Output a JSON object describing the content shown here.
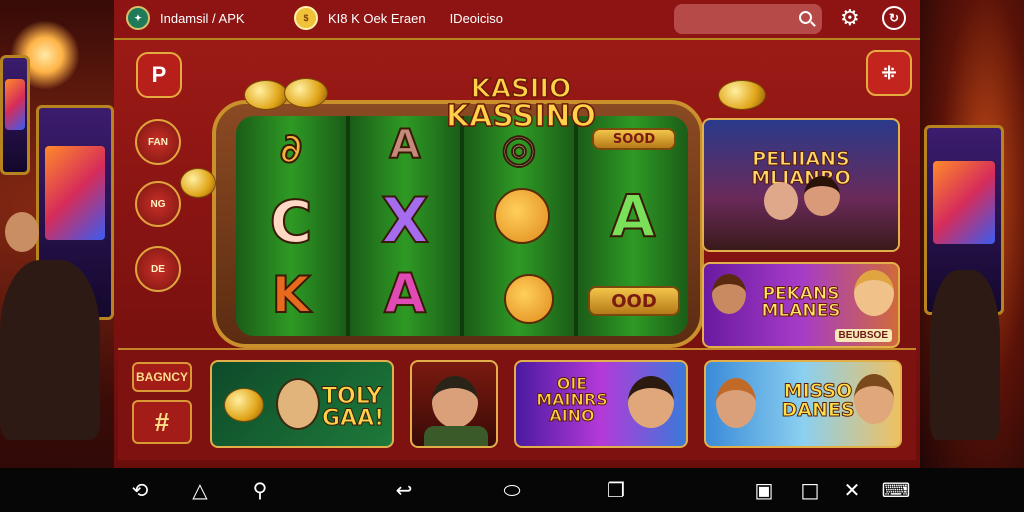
{
  "topbar": {
    "app_label": "Indamsil  / APK",
    "promo_label": "KI8 K  Oek Eraen",
    "promo_extra": "IDeoiciso"
  },
  "colors": {
    "panel": "#8d1412",
    "gold": "#e2b04a",
    "reel_green": "#2e9a24"
  },
  "icons": [
    "search-icon",
    "gear-icon",
    "refresh-icon",
    "menu-icon",
    "back-icon",
    "home-icon",
    "recents-icon"
  ],
  "logo": {
    "line1": "KASIIO",
    "line2": "KASSINO"
  },
  "side_buttons": {
    "first": "P",
    "second": "FAN",
    "third": "NG",
    "fourth": "DE"
  },
  "reels": {
    "col1": [
      "∂",
      "C",
      "K"
    ],
    "col2": [
      "A",
      "X",
      "A"
    ],
    "col3": [
      "◎",
      "",
      ""
    ],
    "col4": [
      "SOOD",
      "A",
      "OOD"
    ]
  },
  "promo_cards": {
    "card1": {
      "line1": "PELIIANS",
      "line2": "MLIANRO"
    },
    "card2": {
      "line1": "PEKANS",
      "line2": "MLANES",
      "badge": "BEUBSOE"
    }
  },
  "bottom": {
    "label_btn": "BAGNCY",
    "hash_btn": "#",
    "tile1": "TOLY GAA!",
    "tile3": {
      "line1": "OIE",
      "line2": "MAINRS",
      "line3": "AINO"
    },
    "tile4": {
      "line1": "MISSO",
      "line2": "DANES"
    }
  }
}
